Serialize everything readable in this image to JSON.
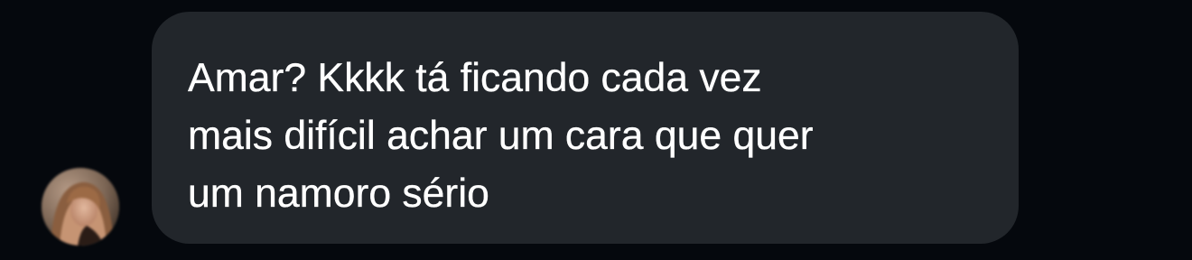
{
  "conversation": {
    "received_message": {
      "lines": [
        "Amar? Kkkk tá ficando cada vez",
        "mais difícil achar um cara que quer",
        "um namoro sério"
      ]
    },
    "sender_avatar": {
      "icon": "profile-photo"
    }
  },
  "colors": {
    "background": "#05080d",
    "bubble": "#22262b",
    "text": "#ffffff"
  }
}
